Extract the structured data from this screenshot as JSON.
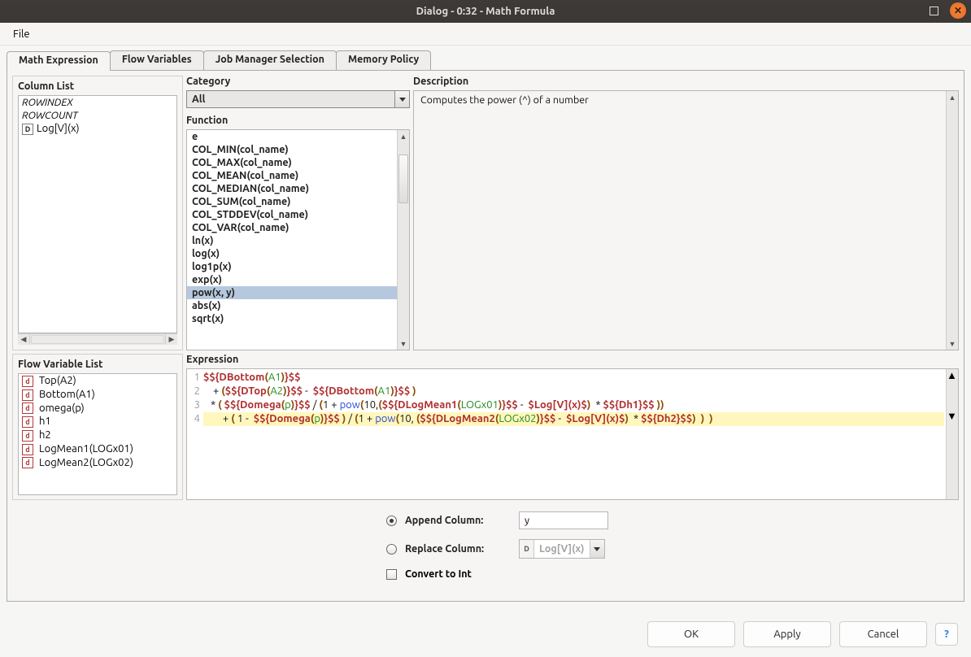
{
  "window": {
    "title": "Dialog - 0:32 - Math Formula"
  },
  "menubar": {
    "file": "File"
  },
  "tabs": [
    {
      "label": "Math Expression",
      "active": true
    },
    {
      "label": "Flow Variables",
      "active": false
    },
    {
      "label": "Job Manager Selection",
      "active": false
    },
    {
      "label": "Memory Policy",
      "active": false
    }
  ],
  "column_list": {
    "title": "Column List",
    "items": [
      {
        "text": "ROWINDEX",
        "style": "italic"
      },
      {
        "text": "ROWCOUNT",
        "style": "italic"
      },
      {
        "text": "Log[V](x)",
        "icon": "D"
      }
    ]
  },
  "category": {
    "title": "Category",
    "value": "All"
  },
  "function_section": {
    "title": "Function",
    "items": [
      "e",
      "COL_MIN(col_name)",
      "COL_MAX(col_name)",
      "COL_MEAN(col_name)",
      "COL_MEDIAN(col_name)",
      "COL_SUM(col_name)",
      "COL_STDDEV(col_name)",
      "COL_VAR(col_name)",
      "ln(x)",
      "log(x)",
      "log1p(x)",
      "exp(x)",
      "pow(x, y)",
      "abs(x)",
      "sqrt(x)"
    ],
    "selected_index": 12
  },
  "description": {
    "title": "Description",
    "text": "Computes the power (^) of a number"
  },
  "flow_variable_list": {
    "title": "Flow Variable List",
    "items": [
      "Top(A2)",
      "Bottom(A1)",
      "omega(p)",
      "h1",
      "h2",
      "LogMean1(LOGx01)",
      "LogMean2(LOGx02)"
    ]
  },
  "expression": {
    "title": "Expression",
    "line_numbers": [
      "1",
      "2",
      "3",
      "4"
    ],
    "lines_plain": [
      "$${DBottom(A1)}$$",
      "    + ($${DTop(A2)}$$ -  $${DBottom(A1)}$$ )",
      "   * ( $${Domega(p)}$$ / (1 + pow(10,($${DLogMean1(LOGx01)}$$ -  $Log[V](x)$)  * $${Dh1}$$ ))",
      "        + ( 1 -  $${Domega(p)}$$ ) / (1 + pow(10, ($${DLogMean2(LOGx02)}$$ -  $Log[V](x)$)  * $${Dh2}$$)  )  )"
    ]
  },
  "options": {
    "append_label": "Append Column:",
    "append_value": "y",
    "replace_label": "Replace Column:",
    "replace_value": "Log[V](x)",
    "convert_label": "Convert to Int",
    "selected": "append"
  },
  "dialog_buttons": {
    "ok": "OK",
    "apply": "Apply",
    "cancel": "Cancel"
  }
}
